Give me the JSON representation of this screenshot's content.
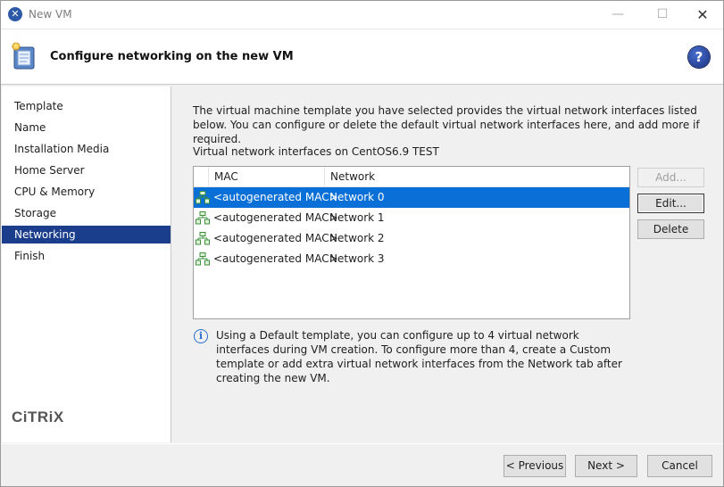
{
  "window": {
    "title": "New VM",
    "minimize": "—",
    "maximize": "☐",
    "close": "✕"
  },
  "header": {
    "title": "Configure networking on the new VM",
    "help": "?"
  },
  "sidebar": {
    "items": [
      {
        "label": "Template",
        "active": false
      },
      {
        "label": "Name",
        "active": false
      },
      {
        "label": "Installation Media",
        "active": false
      },
      {
        "label": "Home Server",
        "active": false
      },
      {
        "label": "CPU & Memory",
        "active": false
      },
      {
        "label": "Storage",
        "active": false
      },
      {
        "label": "Networking",
        "active": true
      },
      {
        "label": "Finish",
        "active": false
      }
    ],
    "logo_text": "CiTRiX"
  },
  "main": {
    "intro": "The virtual machine template you have selected provides the virtual network interfaces listed below. You can configure or delete the default virtual network interfaces here, and add more if required.",
    "list_label": "Virtual network interfaces on CentOS6.9 TEST",
    "columns": [
      "MAC",
      "Network"
    ],
    "rows": [
      {
        "mac": "<autogenerated MAC>",
        "network": "Network 0",
        "selected": true
      },
      {
        "mac": "<autogenerated MAC>",
        "network": "Network 1",
        "selected": false
      },
      {
        "mac": "<autogenerated MAC>",
        "network": "Network 2",
        "selected": false
      },
      {
        "mac": "<autogenerated MAC>",
        "network": "Network 3",
        "selected": false
      }
    ],
    "buttons": {
      "add": "Add...",
      "edit": "Edit...",
      "delete": "Delete"
    },
    "info_icon": "i",
    "info": "Using a Default template, you can configure up to 4 virtual network interfaces during VM creation. To configure more than 4, create a Custom template or add extra virtual network interfaces from the Network tab after creating the new VM."
  },
  "footer": {
    "previous": "< Previous",
    "next": "Next >",
    "cancel": "Cancel"
  },
  "colors": {
    "selection": "#0a6fd6",
    "nav_active": "#1a3e8c",
    "help_blue": "#17307e",
    "info_blue": "#2a6fd1"
  },
  "icons": {
    "app": "xenserver-icon",
    "header": "vm-wizard-icon",
    "row": "network-interface-icon",
    "info": "info-icon"
  }
}
